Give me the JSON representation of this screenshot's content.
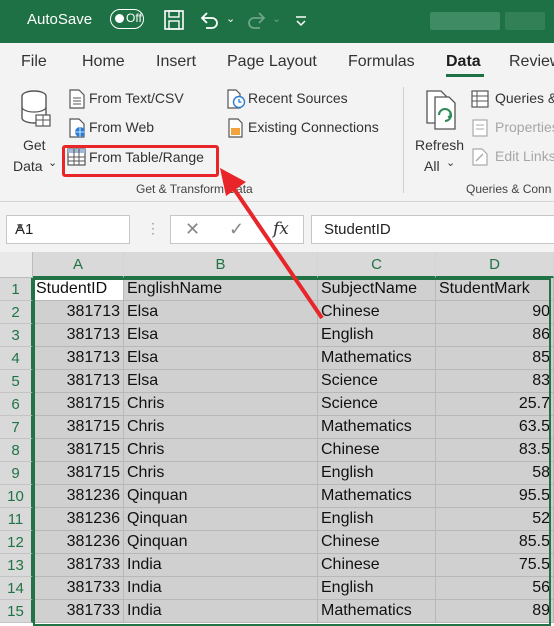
{
  "titlebar": {
    "autosave_label": "AutoSave",
    "toggle_state": "Off"
  },
  "tabs": [
    "File",
    "Home",
    "Insert",
    "Page Layout",
    "Formulas",
    "Data",
    "Review"
  ],
  "active_tab": "Data",
  "ribbon": {
    "get_data_line1": "Get",
    "get_data_line2": "Data",
    "from_text_csv": "From Text/CSV",
    "from_web": "From Web",
    "from_table_range": "From Table/Range",
    "recent_sources": "Recent Sources",
    "existing_connections": "Existing Connections",
    "group1_label": "Get & Transform Data",
    "refresh_line1": "Refresh",
    "refresh_line2": "All",
    "queries": "Queries &",
    "properties": "Properties",
    "edit_links": "Edit Links",
    "group2_label": "Queries & Conn"
  },
  "formula_bar": {
    "name_box": "A1",
    "content": "StudentID",
    "fx": "fx"
  },
  "columns": [
    "A",
    "B",
    "C",
    "D"
  ],
  "rows": [
    {
      "n": "1",
      "a": "StudentID",
      "b": "EnglishName",
      "c": "SubjectName",
      "d": "StudentMark"
    },
    {
      "n": "2",
      "a": "381713",
      "b": "Elsa",
      "c": "Chinese",
      "d": "90"
    },
    {
      "n": "3",
      "a": "381713",
      "b": "Elsa",
      "c": "English",
      "d": "86"
    },
    {
      "n": "4",
      "a": "381713",
      "b": "Elsa",
      "c": "Mathematics",
      "d": "85"
    },
    {
      "n": "5",
      "a": "381713",
      "b": "Elsa",
      "c": "Science",
      "d": "83"
    },
    {
      "n": "6",
      "a": "381715",
      "b": "Chris",
      "c": "Science",
      "d": "25.7"
    },
    {
      "n": "7",
      "a": "381715",
      "b": "Chris",
      "c": "Mathematics",
      "d": "63.5"
    },
    {
      "n": "8",
      "a": "381715",
      "b": "Chris",
      "c": "Chinese",
      "d": "83.5"
    },
    {
      "n": "9",
      "a": "381715",
      "b": "Chris",
      "c": "English",
      "d": "58"
    },
    {
      "n": "10",
      "a": "381236",
      "b": "Qinquan",
      "c": "Mathematics",
      "d": "95.5"
    },
    {
      "n": "11",
      "a": "381236",
      "b": "Qinquan",
      "c": "English",
      "d": "52"
    },
    {
      "n": "12",
      "a": "381236",
      "b": "Qinquan",
      "c": "Chinese",
      "d": "85.5"
    },
    {
      "n": "13",
      "a": "381733",
      "b": "India",
      "c": "Chinese",
      "d": "75.5"
    },
    {
      "n": "14",
      "a": "381733",
      "b": "India",
      "c": "English",
      "d": "56"
    },
    {
      "n": "15",
      "a": "381733",
      "b": "India",
      "c": "Mathematics",
      "d": "89"
    }
  ],
  "colors": {
    "excel_green": "#1e7145",
    "highlight_red": "#e8262a"
  },
  "icons": [
    "save-icon",
    "undo-icon",
    "redo-icon",
    "customize-toolbar-icon",
    "database-icon",
    "text-file-icon",
    "web-icon",
    "table-icon",
    "recent-sources-icon",
    "connections-icon",
    "refresh-icon"
  ]
}
